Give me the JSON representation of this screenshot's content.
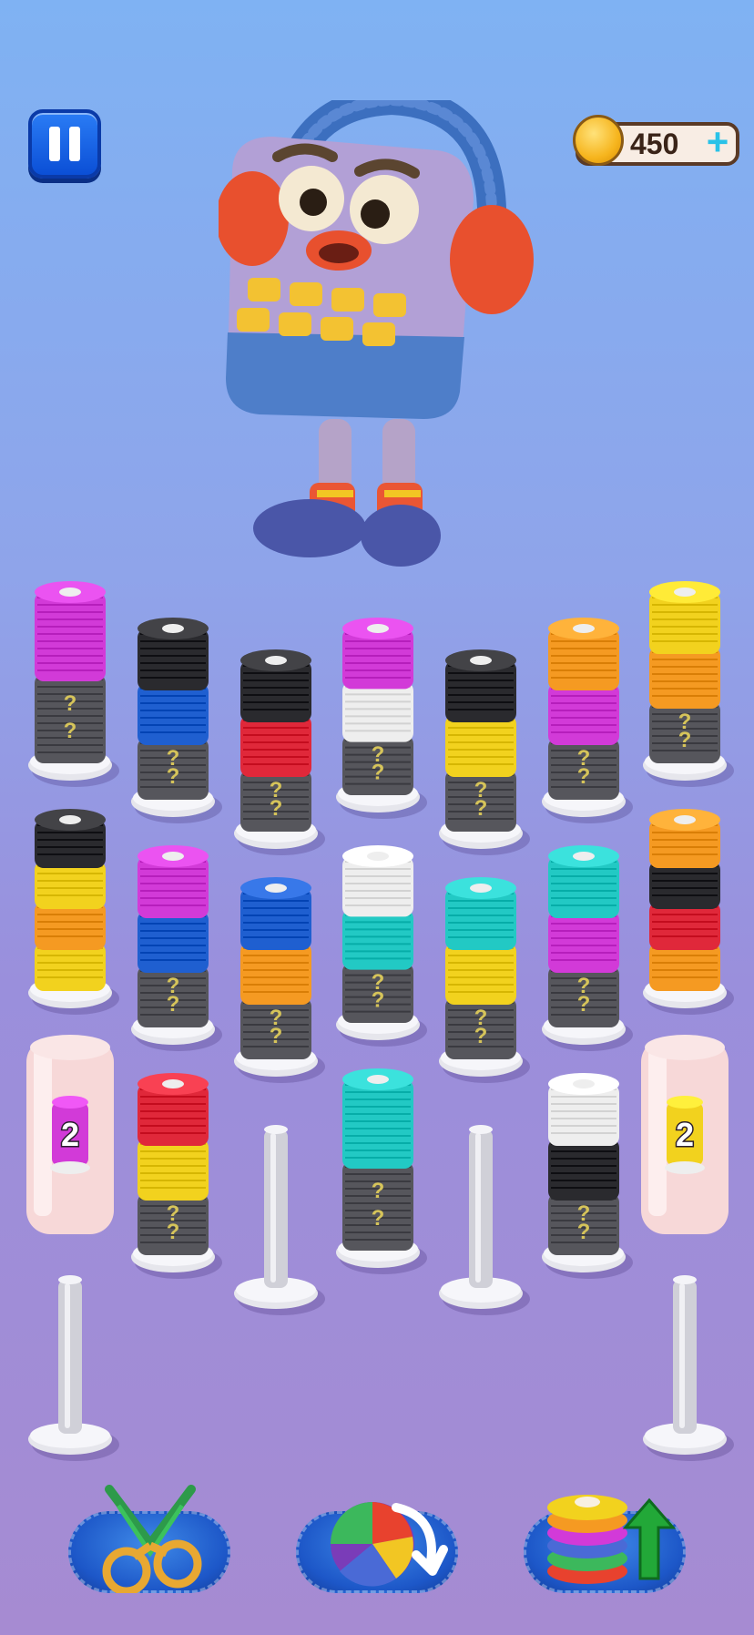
{
  "hud": {
    "coins": "450",
    "plus_label": "+",
    "pause_icon": "pause-icon",
    "coin_icon": "gold-coin-icon"
  },
  "colors": {
    "magenta": "#d23ad8",
    "black": "#2a2a2e",
    "blue": "#1f5fd0",
    "red": "#e0283a",
    "white": "#eeeeee",
    "yellow": "#f2d21e",
    "orange": "#f59a22",
    "cyan": "#22c9c4",
    "hidden": "#56565c"
  },
  "spools": [
    {
      "stack": [
        "magenta",
        "hidden"
      ],
      "hidden_marks": [
        "?",
        "?"
      ]
    },
    {
      "stack": [
        "black",
        "blue",
        "hidden"
      ],
      "hidden_marks": [
        "?",
        "?"
      ]
    },
    {
      "stack": [
        "black",
        "red",
        "hidden"
      ],
      "hidden_marks": [
        "?",
        "?"
      ]
    },
    {
      "stack": [
        "magenta",
        "white",
        "hidden"
      ],
      "hidden_marks": [
        "?",
        "?"
      ]
    },
    {
      "stack": [
        "black",
        "yellow",
        "hidden"
      ],
      "hidden_marks": [
        "?",
        "?"
      ]
    },
    {
      "stack": [
        "orange",
        "magenta",
        "hidden"
      ],
      "hidden_marks": [
        "?",
        "?"
      ]
    },
    {
      "stack": [
        "yellow",
        "orange",
        "hidden"
      ],
      "hidden_marks": [
        "?",
        "?"
      ]
    },
    {
      "stack": [
        "black",
        "yellow",
        "orange",
        "yellow"
      ],
      "hidden_marks": []
    },
    {
      "stack": [
        "magenta",
        "blue",
        "hidden"
      ],
      "hidden_marks": [
        "?",
        "?"
      ]
    },
    {
      "stack": [
        "blue",
        "orange",
        "hidden"
      ],
      "hidden_marks": [
        "?",
        "?"
      ]
    },
    {
      "stack": [
        "white",
        "cyan",
        "hidden"
      ],
      "hidden_marks": [
        "?",
        "?"
      ]
    },
    {
      "stack": [
        "cyan",
        "yellow",
        "hidden"
      ],
      "hidden_marks": [
        "?",
        "?"
      ]
    },
    {
      "stack": [
        "cyan",
        "magenta",
        "hidden"
      ],
      "hidden_marks": [
        "?",
        "?"
      ]
    },
    {
      "stack": [
        "orange",
        "black",
        "red",
        "orange"
      ],
      "hidden_marks": []
    },
    {
      "stack": [
        "red",
        "yellow",
        "hidden"
      ],
      "hidden_marks": [
        "?",
        "?"
      ]
    },
    {
      "stack": [
        "cyan",
        "hidden"
      ],
      "hidden_marks": [
        "?",
        "?"
      ]
    },
    {
      "stack": [
        "white",
        "black",
        "hidden"
      ],
      "hidden_marks": [
        "?",
        "?"
      ]
    }
  ],
  "locked_cups": [
    {
      "count": "2",
      "color": "magenta"
    },
    {
      "count": "2",
      "color": "yellow"
    }
  ],
  "boosters": [
    {
      "name": "scissors-booster",
      "icon": "scissors-icon"
    },
    {
      "name": "shuffle-booster",
      "icon": "shuffle-yarn-icon"
    },
    {
      "name": "extra-pole-booster",
      "icon": "stack-up-arrow-icon"
    }
  ]
}
